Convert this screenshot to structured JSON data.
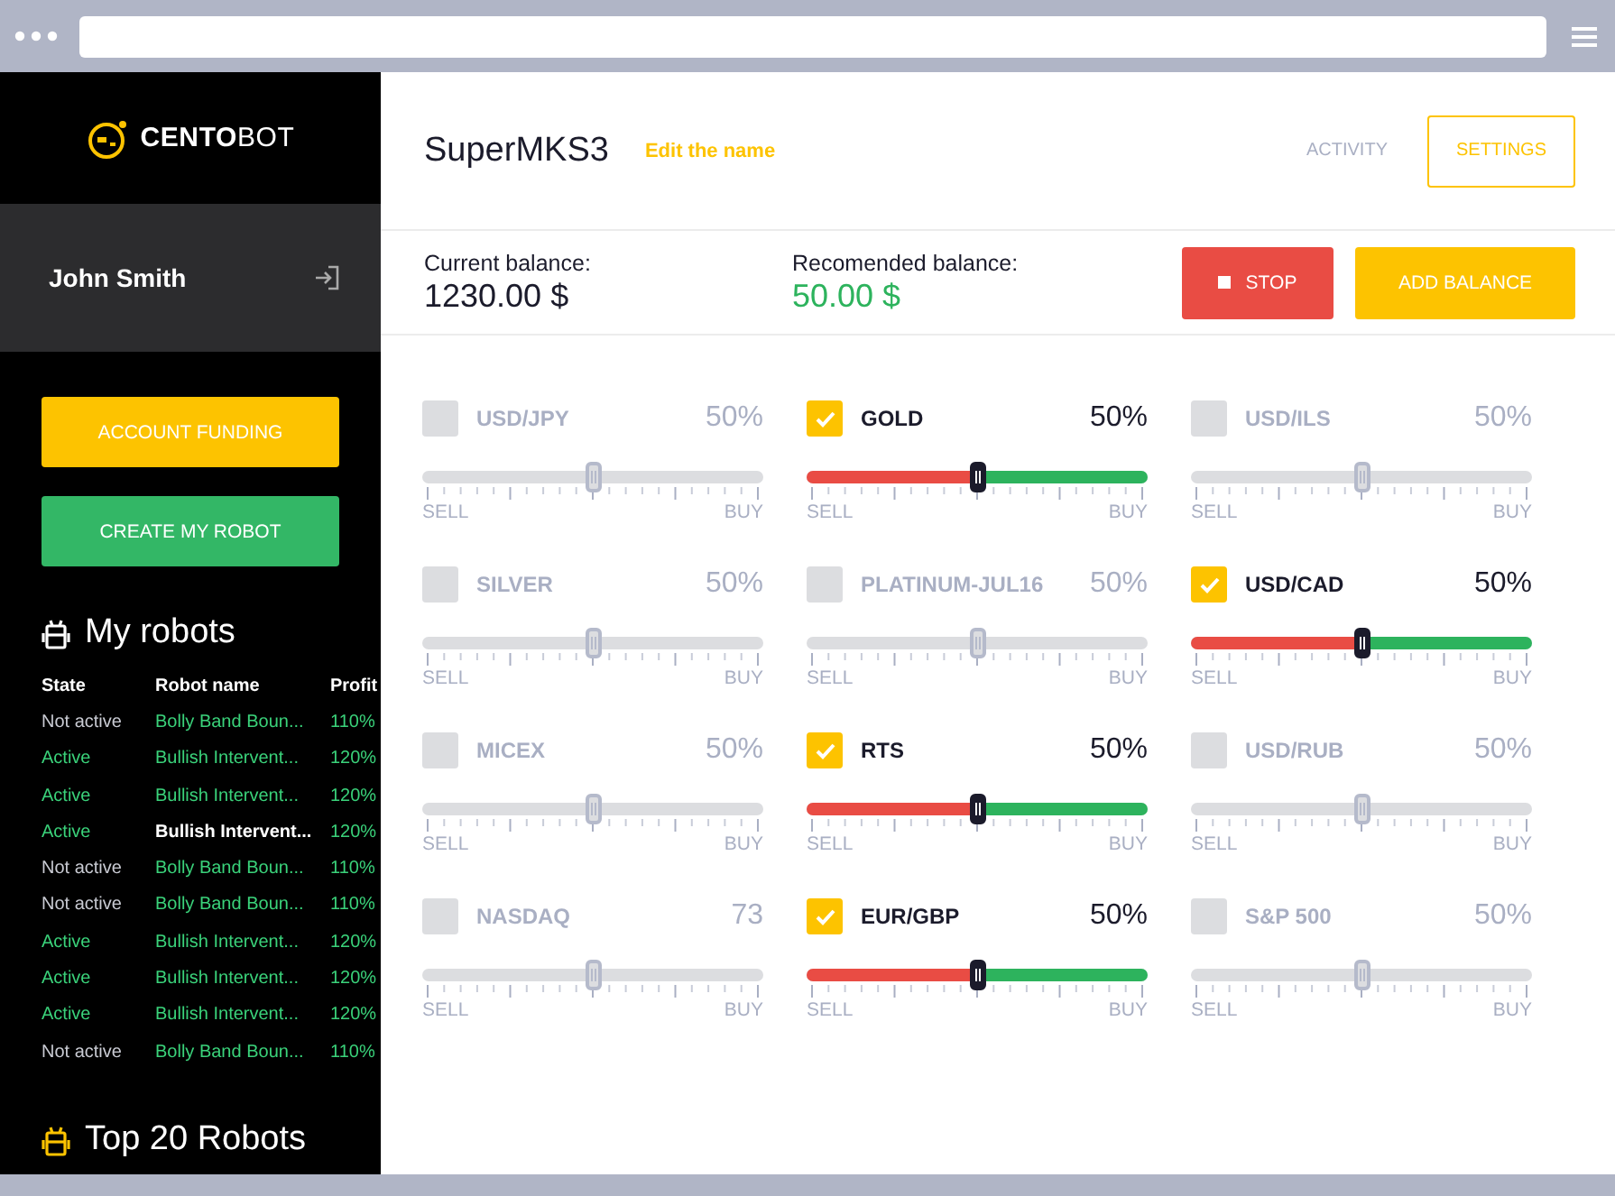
{
  "brand": {
    "name": "**CENTO**BOT"
  },
  "user": {
    "name": "John Smith"
  },
  "sidebar_buttons": [
    {
      "label": "ACCOUNT FUNDING",
      "kind": "funding"
    },
    {
      "label": "CREATE MY ROBOT",
      "kind": "create"
    }
  ],
  "my_robots": {
    "title": "My robots",
    "columns": [
      "State",
      "Robot name",
      "Profit"
    ],
    "rows": [
      {
        "state": "Not active",
        "active": false,
        "name": "Bolly Band Boun...",
        "profit": "110%",
        "selected": false
      },
      {
        "state": "Active",
        "active": true,
        "name": "Bullish Intervent...",
        "profit": "120%",
        "selected": false
      },
      {
        "state": "Active",
        "active": true,
        "name": "Bullish Intervent...",
        "profit": "120%",
        "selected": false
      },
      {
        "state": "Active",
        "active": true,
        "name": "Bullish Intervent...",
        "profit": "120%",
        "selected": true
      },
      {
        "state": "Not active",
        "active": false,
        "name": "Bolly Band Boun...",
        "profit": "110%",
        "selected": false
      },
      {
        "state": "Not active",
        "active": false,
        "name": "Bolly Band Boun...",
        "profit": "110%",
        "selected": false
      },
      {
        "state": "Active",
        "active": true,
        "name": "Bullish Intervent...",
        "profit": "120%",
        "selected": false
      },
      {
        "state": "Active",
        "active": true,
        "name": "Bullish Intervent...",
        "profit": "120%",
        "selected": false
      },
      {
        "state": "Active",
        "active": true,
        "name": "Bullish Intervent...",
        "profit": "120%",
        "selected": false
      },
      {
        "state": "Not active",
        "active": false,
        "name": "Bolly Band Boun...",
        "profit": "110%",
        "selected": false
      }
    ]
  },
  "top_robots": {
    "title": "Top 20 Robots"
  },
  "header": {
    "title": "SuperMKS3",
    "edit_link": "Edit the name",
    "tabs": [
      {
        "label": "ACTIVITY",
        "selected": false
      },
      {
        "label": "SETTINGS",
        "selected": true
      }
    ]
  },
  "balance": {
    "current_label": "Current balance:",
    "current_value": "1230.00 $",
    "recommended_label": "Recomended balance:",
    "recommended_value": "50.00 $",
    "buttons": [
      {
        "label": "STOP",
        "kind": "stop"
      },
      {
        "label": "ADD BALANCE",
        "kind": "add"
      }
    ]
  },
  "instruments": [
    {
      "name": "USD/JPY",
      "checked": false,
      "value": "50%",
      "level": 0.5,
      "sell": "SELL",
      "buy": "BUY"
    },
    {
      "name": "GOLD",
      "checked": true,
      "value": "50%",
      "level": 0.5,
      "sell": "SELL",
      "buy": "BUY"
    },
    {
      "name": "USD/ILS",
      "checked": false,
      "value": "50%",
      "level": 0.5,
      "sell": "SELL",
      "buy": "BUY"
    },
    {
      "name": "SILVER",
      "checked": false,
      "value": "50%",
      "level": 0.5,
      "sell": "SELL",
      "buy": "BUY"
    },
    {
      "name": "PLATINUM-JUL16",
      "checked": false,
      "value": "50%",
      "level": 0.5,
      "sell": "SELL",
      "buy": "BUY"
    },
    {
      "name": "USD/CAD",
      "checked": true,
      "value": "50%",
      "level": 0.5,
      "sell": "SELL",
      "buy": "BUY"
    },
    {
      "name": "MICEX",
      "checked": false,
      "value": "50%",
      "level": 0.5,
      "sell": "SELL",
      "buy": "BUY"
    },
    {
      "name": "RTS",
      "checked": true,
      "value": "50%",
      "level": 0.5,
      "sell": "SELL",
      "buy": "BUY"
    },
    {
      "name": "USD/RUB",
      "checked": false,
      "value": "50%",
      "level": 0.5,
      "sell": "SELL",
      "buy": "BUY"
    },
    {
      "name": "NASDAQ",
      "checked": false,
      "value": "73",
      "level": 0.5,
      "sell": "SELL",
      "buy": "BUY"
    },
    {
      "name": "EUR/GBP",
      "checked": true,
      "value": "50%",
      "level": 0.5,
      "sell": "SELL",
      "buy": "BUY"
    },
    {
      "name": "S&P 500",
      "checked": false,
      "value": "50%",
      "level": 0.5,
      "sell": "SELL",
      "buy": "BUY"
    }
  ]
}
